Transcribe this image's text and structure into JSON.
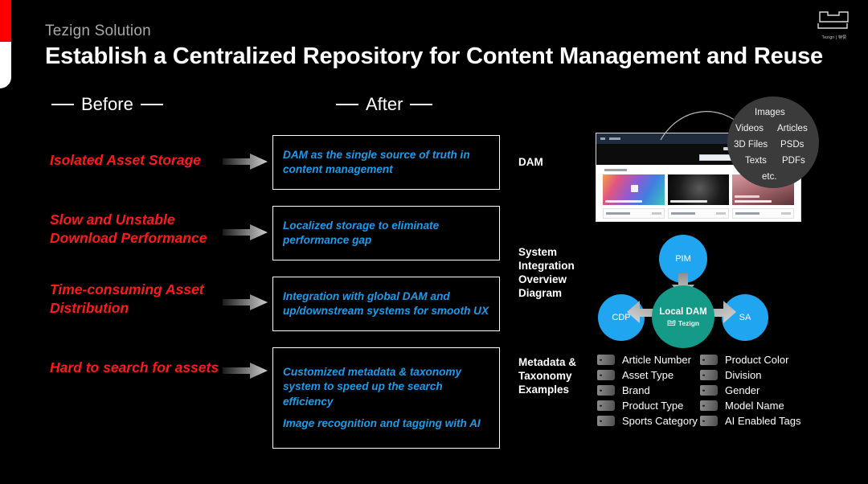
{
  "header": {
    "eyebrow": "Tezign Solution",
    "title": "Establish a Centralized Repository for Content Management and Reuse",
    "brand_word": "Tezign | 特赞"
  },
  "columns": {
    "before_label": "Before",
    "after_label": "After"
  },
  "before_items": [
    {
      "text": "Isolated Asset Storage"
    },
    {
      "text": "Slow and Unstable Download Performance"
    },
    {
      "text": "Time-consuming Asset Distribution"
    },
    {
      "text": "Hard to search for assets"
    }
  ],
  "after_boxes": [
    {
      "lines": [
        "DAM as the single source of truth in content management"
      ]
    },
    {
      "lines": [
        "Localized storage to eliminate performance gap"
      ]
    },
    {
      "lines": [
        "Integration with global DAM and up/downstream systems for smooth UX"
      ]
    },
    {
      "lines": [
        "Customized metadata & taxonomy system to speed up the search efficiency",
        "Image recognition and tagging with AI"
      ]
    }
  ],
  "side_labels": {
    "dam": "DAM",
    "integration": "System Integration Overview Diagram",
    "metadata": "Metadata & Taxonomy Examples"
  },
  "file_types": {
    "images": "Images",
    "videos": "Videos",
    "articles": "Articles",
    "three_d_files": "3D Files",
    "psds": "PSDs",
    "texts": "Texts",
    "pdfs": "PDFs",
    "etc": "etc."
  },
  "diagram": {
    "pim": "PIM",
    "cdp": "CDP",
    "sa": "SA",
    "local_dam": "Local DAM",
    "local_dam_brand": "Tezign"
  },
  "metadata_tags": {
    "col1": [
      "Article Number",
      "Asset Type",
      "Brand",
      "Product Type",
      "Sports Category"
    ],
    "col2": [
      "Product Color",
      "Division",
      "Gender",
      "Model Name",
      "AI Enabled Tags"
    ]
  },
  "colors": {
    "background": "#000000",
    "accent_red": "#ff1a1a",
    "accent_blue": "#1e9bea",
    "node_blue": "#20a6f0",
    "node_green": "#149a86",
    "eyebrow_gray": "#a8a8a8"
  }
}
